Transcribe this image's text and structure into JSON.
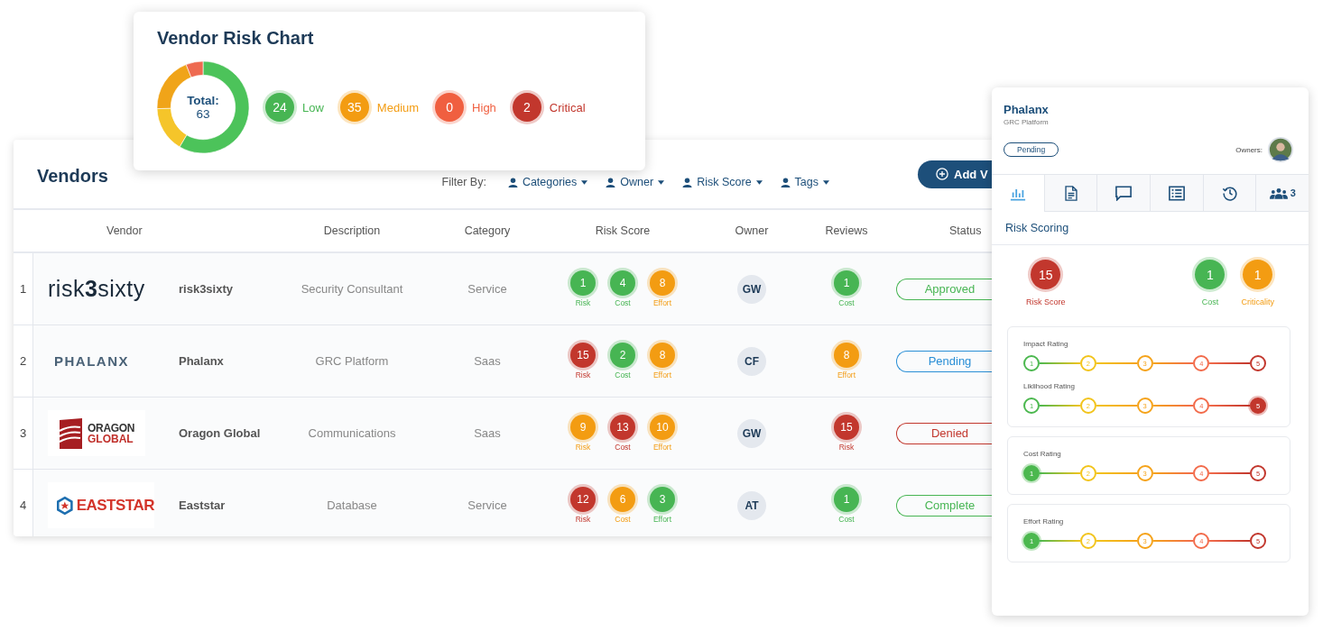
{
  "chart_card": {
    "title": "Vendor Risk Chart",
    "total_label": "Total:",
    "total_value": "63",
    "legend": [
      {
        "count": "24",
        "label": "Low",
        "color": "#47b553"
      },
      {
        "count": "35",
        "label": "Medium",
        "color": "#f39c12"
      },
      {
        "count": "0",
        "label": "High",
        "color": "#f05f40"
      },
      {
        "count": "2",
        "label": "Critical",
        "color": "#c2372d"
      }
    ]
  },
  "vendors": {
    "title": "Vendors",
    "filter_label": "Filter By:",
    "filters": [
      "Categories",
      "Owner",
      "Risk Score",
      "Tags"
    ],
    "add_button": "Add V",
    "columns": [
      "Vendor",
      "Description",
      "Category",
      "Risk Score",
      "Owner",
      "Reviews",
      "Status"
    ],
    "rows": [
      {
        "index": "1",
        "logo": {
          "kind": "wordmark",
          "text": [
            "risk**3**sixty"
          ]
        },
        "name": "risk3sixty",
        "description": "Security Consultant",
        "category": "Service",
        "scores": [
          {
            "value": "1",
            "label": "Risk",
            "color": "#47b553"
          },
          {
            "value": "4",
            "label": "Cost",
            "color": "#47b553"
          },
          {
            "value": "8",
            "label": "Effort",
            "color": "#f39c12"
          }
        ],
        "owner": "GW",
        "review": {
          "value": "1",
          "label": "Cost",
          "color": "#47b553"
        },
        "status": {
          "label": "Approved",
          "color": "#47b553"
        }
      },
      {
        "index": "2",
        "logo": {
          "kind": "spaced",
          "text": [
            "PHALANX"
          ]
        },
        "name": "Phalanx",
        "description": "GRC Platform",
        "category": "Saas",
        "scores": [
          {
            "value": "15",
            "label": "Risk",
            "color": "#c2372d"
          },
          {
            "value": "2",
            "label": "Cost",
            "color": "#47b553"
          },
          {
            "value": "8",
            "label": "Effort",
            "color": "#f39c12"
          }
        ],
        "owner": "CF",
        "review": {
          "value": "8",
          "label": "Effort",
          "color": "#f39c12"
        },
        "status": {
          "label": "Pending",
          "color": "#2a8fd6"
        }
      },
      {
        "index": "3",
        "logo": {
          "kind": "square-emblem",
          "text": [
            "ORAGON",
            "GLOBAL"
          ]
        },
        "name": "Oragon Global",
        "description": "Communications",
        "category": "Saas",
        "scores": [
          {
            "value": "9",
            "label": "Risk",
            "color": "#f39c12"
          },
          {
            "value": "13",
            "label": "Cost",
            "color": "#c2372d"
          },
          {
            "value": "10",
            "label": "Effort",
            "color": "#f39c12"
          }
        ],
        "owner": "GW",
        "review": {
          "value": "15",
          "label": "Risk",
          "color": "#c2372d"
        },
        "status": {
          "label": "Denied",
          "color": "#c2372d"
        }
      },
      {
        "index": "4",
        "logo": {
          "kind": "hex-emblem",
          "text": [
            "EASTSTAR"
          ]
        },
        "name": "Eaststar",
        "description": "Database",
        "category": "Service",
        "scores": [
          {
            "value": "12",
            "label": "Risk",
            "color": "#c2372d"
          },
          {
            "value": "6",
            "label": "Cost",
            "color": "#f39c12"
          },
          {
            "value": "3",
            "label": "Effort",
            "color": "#47b553"
          }
        ],
        "owner": "AT",
        "review": {
          "value": "1",
          "label": "Cost",
          "color": "#47b553"
        },
        "status": {
          "label": "Complete",
          "color": "#47b553"
        }
      }
    ]
  },
  "panel": {
    "title": "Phalanx",
    "subtitle": "GRC Platform",
    "status": "Pending",
    "owners_label": "Owners:",
    "tabs": [
      {
        "kind": "chart",
        "selected": true
      },
      {
        "kind": "document",
        "selected": false
      },
      {
        "kind": "comment",
        "selected": false
      },
      {
        "kind": "list",
        "selected": false
      },
      {
        "kind": "history",
        "selected": false
      },
      {
        "kind": "people",
        "count": "3",
        "selected": false
      }
    ],
    "section": "Risk Scoring",
    "scores": [
      {
        "value": "15",
        "label": "Risk Score",
        "color": "#c2372d"
      },
      {
        "value": "1",
        "label": "Cost",
        "color": "#47b553"
      },
      {
        "value": "1",
        "label": "Criticality",
        "color": "#f39c12"
      }
    ],
    "rating_groups": [
      {
        "ratings": [
          {
            "label": "Impact Rating",
            "steps": [
              {
                "label": "1",
                "color": "#4cb84f",
                "selected": false
              },
              {
                "label": "2",
                "color": "#f2c41c",
                "selected": false
              },
              {
                "label": "3",
                "color": "#f5a31a",
                "selected": false
              },
              {
                "label": "4",
                "color": "#f26b4b",
                "selected": false
              },
              {
                "label": "5",
                "color": "#c2372d",
                "selected": false
              }
            ]
          },
          {
            "label": "Liklihood Rating",
            "steps": [
              {
                "label": "1",
                "color": "#4cb84f",
                "selected": false
              },
              {
                "label": "2",
                "color": "#f2c41c",
                "selected": false
              },
              {
                "label": "3",
                "color": "#f5a31a",
                "selected": false
              },
              {
                "label": "4",
                "color": "#f26b4b",
                "selected": false
              },
              {
                "label": "5",
                "color": "#c2372d",
                "selected": true
              }
            ]
          }
        ]
      },
      {
        "ratings": [
          {
            "label": "Cost Rating",
            "steps": [
              {
                "label": "1",
                "color": "#4cb84f",
                "selected": true
              },
              {
                "label": "2",
                "color": "#f2c41c",
                "selected": false
              },
              {
                "label": "3",
                "color": "#f5a31a",
                "selected": false
              },
              {
                "label": "4",
                "color": "#f26b4b",
                "selected": false
              },
              {
                "label": "5",
                "color": "#c2372d",
                "selected": false
              }
            ]
          }
        ]
      },
      {
        "ratings": [
          {
            "label": "Effort Rating",
            "steps": [
              {
                "label": "1",
                "color": "#4cb84f",
                "selected": true
              },
              {
                "label": "2",
                "color": "#f2c41c",
                "selected": false
              },
              {
                "label": "3",
                "color": "#f5a31a",
                "selected": false
              },
              {
                "label": "4",
                "color": "#f26b4b",
                "selected": false
              },
              {
                "label": "5",
                "color": "#c2372d",
                "selected": false
              }
            ]
          }
        ]
      }
    ]
  }
}
